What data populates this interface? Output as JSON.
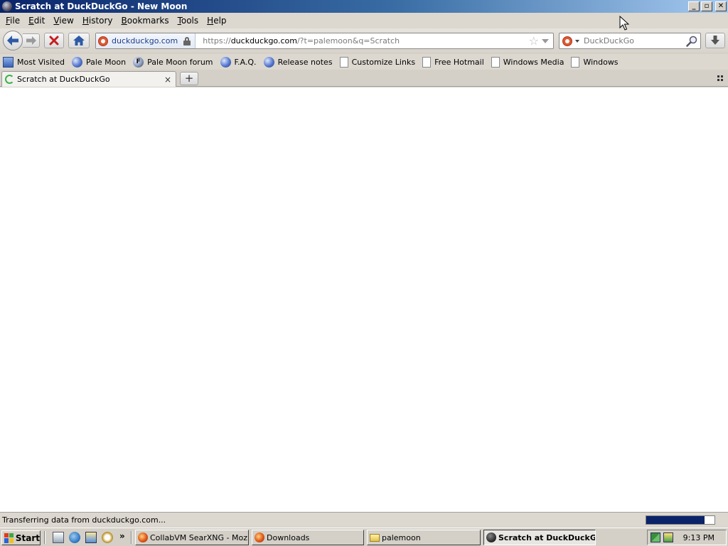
{
  "window": {
    "title": "Scratch at DuckDuckGo - New Moon",
    "buttons": {
      "minimize": "_",
      "restore": "▫",
      "close": "✕"
    }
  },
  "menu": [
    {
      "underline": "F",
      "rest": "ile"
    },
    {
      "underline": "E",
      "rest": "dit"
    },
    {
      "underline": "V",
      "rest": "iew"
    },
    {
      "underline": "H",
      "rest": "istory"
    },
    {
      "underline": "B",
      "rest": "ookmarks"
    },
    {
      "underline": "T",
      "rest": "ools"
    },
    {
      "underline": "H",
      "rest": "elp"
    }
  ],
  "nav": {
    "identity": "duckduckgo.com",
    "url_prefix": "https://",
    "url_host": "duckduckgo.com",
    "url_path": "/?t=palemoon&q=Scratch",
    "search_placeholder": "DuckDuckGo"
  },
  "bookmarks": [
    {
      "label": "Most Visited",
      "icon": "most-visited-icon"
    },
    {
      "label": "Pale Moon",
      "icon": "globe-icon"
    },
    {
      "label": "Pale Moon forum",
      "icon": "forum-icon"
    },
    {
      "label": "F.A.Q.",
      "icon": "globe-icon"
    },
    {
      "label": "Release notes",
      "icon": "globe-icon"
    },
    {
      "label": "Customize Links",
      "icon": "page-icon"
    },
    {
      "label": "Free Hotmail",
      "icon": "page-icon"
    },
    {
      "label": "Windows Media",
      "icon": "page-icon"
    },
    {
      "label": "Windows",
      "icon": "page-icon"
    }
  ],
  "tabs": [
    {
      "title": "Scratch at DuckDuckGo",
      "close": "×"
    }
  ],
  "newtab_label": "+",
  "status": {
    "text": "Transferring data from duckduckgo.com...",
    "progress": 0.85
  },
  "taskbar": {
    "start_label": "Start",
    "more": "»",
    "tasks": [
      {
        "label": "CollabVM SearXNG - Mozill...",
        "icon": "firefox-icon"
      },
      {
        "label": "Downloads",
        "icon": "firefox-icon"
      },
      {
        "label": "palemoon",
        "icon": "folder-icon"
      },
      {
        "label": "Scratch at DuckDuckG...",
        "icon": "pale-moon-icon"
      }
    ],
    "clock": "9:13 PM"
  }
}
